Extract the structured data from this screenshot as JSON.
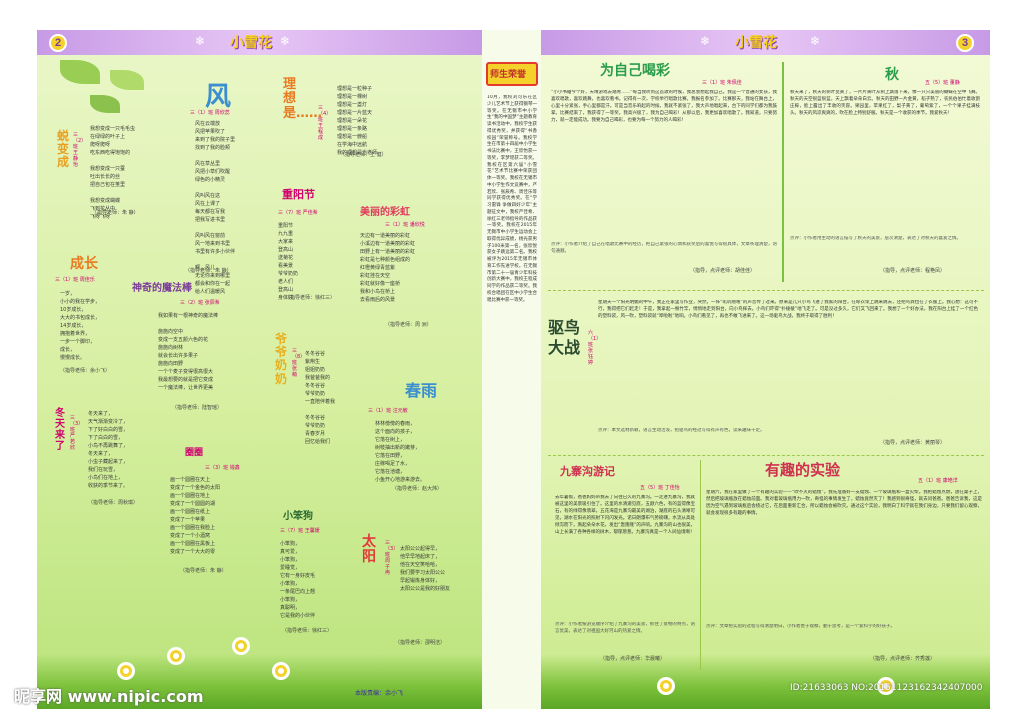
{
  "header": {
    "left_page_num": "2",
    "right_page_num": "3",
    "masthead": "小雪花",
    "spine_title": "师生荣誉",
    "snowflake": "❄"
  },
  "left": {
    "feng": {
      "title": "风",
      "author": "三（1）班 周欣蕊",
      "lines": [
        "风在云端放",
        "风把苹果吹了",
        "来到了我的院子里",
        "找到了我的脸颊",
        "",
        "风在草丛里",
        "风把小草们吹醒",
        "绿色的小精灵",
        "",
        "风叫风在这",
        "风在上课了",
        "每天都在写我",
        "把我写进书里",
        "",
        "风叫风在窗前",
        "风一地来到书里",
        "书里有许多小伙伴",
        "",
        "啊，风儿",
        "无论你来到哪里",
        "都会和你在一起",
        "给人们温暖风"
      ],
      "teacher": "（指导老师：朱 静）"
    },
    "bianc": {
      "title": "蜕变成",
      "author": "三（2）班 王静怡",
      "lines": [
        "我想变成一只毛毛虫",
        "在绿绿的叶子上",
        "爬呀爬呀",
        "吃东西吃得饱饱的",
        "",
        "我想变成一只蚕",
        "吐出长长的丝",
        "把自己包在茧里",
        "",
        "我想变成蝴蝶",
        "飞到花丛中",
        "飞呀飞呀"
      ],
      "teacher": "（指导老师：朱 静）"
    },
    "lixiang": {
      "title": "理想是……",
      "author": "三（4）班 王程成",
      "lines": [
        "理想是一粒种子",
        "理想是一棵树",
        "理想是一盏灯",
        "理想是一片蓝天",
        "理想是一朵花",
        "理想是一条路",
        "理想是一艘船",
        "在学海中远航",
        "我的理想是当老师"
      ],
      "teacher": "（指导老师：王 健）"
    },
    "chengzhang": {
      "title": "成长",
      "author": "三（1）班 周佳乐",
      "lines": [
        "一岁，",
        "小小的我在学步，",
        "10岁成长，",
        "大大的书包成长，",
        "14岁成长，",
        "拥抱着世界，",
        "一步一个脚印，",
        "成长，",
        "慢慢成长。"
      ],
      "teacher": "（指导老师：余小飞）"
    },
    "mofa": {
      "title": "神奇的魔法棒",
      "author": "三（2）班 张辰希",
      "lines": [
        "我如果有一根神奇的魔法棒",
        "",
        "施施向空中",
        "变成一支五颜六色的花",
        "施施向树林",
        "就会长出许多果子",
        "施施向田野",
        "一个个麦子变得很高很大",
        "我最想要的就是把它变成",
        "一个魔法棒，让世界更美"
      ],
      "teacher": "（指导老师：陆智瑶）"
    },
    "chongyang": {
      "title": "重阳节",
      "author": "三（7）班 严佳希",
      "lines": [
        "重阳节",
        "九九重",
        "大家来",
        "登高山",
        "送菊花",
        "看美景",
        "爷爷奶奶",
        "老人们",
        "登高山",
        "身体好"
      ],
      "teacher": "（指导老师：徐红三）"
    },
    "meili": {
      "title": "美丽的彩虹",
      "author": "三（1）班 潘欣悦",
      "lines": [
        "天边有一道美丽的彩虹",
        "小溪边有一道美丽的彩虹",
        "田野上有一道美丽的彩虹",
        "彩虹是七种颜色组成的",
        "红橙黄绿青蓝紫",
        "彩虹挂在天空",
        "彩虹就好像一座桥",
        "我和小鸟在桥上",
        "去看雨后的风景"
      ],
      "teacher": "（指导老师：周 洲）"
    },
    "yeye": {
      "title": "爷爷奶奶",
      "author": "三（8）班 张萌",
      "lines": [
        "冬冬谷谷",
        "紫荆生",
        "姐姐奶奶",
        "我爸爸我的",
        "冬冬谷谷",
        "爷爷奶奶",
        "一直陪伴着我",
        "",
        "冬冬谷谷",
        "爷爷奶奶",
        "青春岁月",
        "回忆给我们"
      ],
      "teacher": ""
    },
    "quanquan": {
      "title": "圈圈",
      "author": "三（3）班 钱鑫",
      "lines": [
        "画一个圆圈在天上",
        "变成了一个金色的太阳",
        "画一个圆圈在地上",
        "变成了一个圆圆的湖",
        "画一个圆圈在纸上",
        "变成了一个苹果",
        "画一个圆圈在我脸上",
        "变成了一个小酒窝",
        "画一个圆圈在黑板上",
        "变成了一个大大的零"
      ],
      "teacher": "（指导老师：朱 静）"
    },
    "chunyu": {
      "title": "春雨",
      "author": "三（1）班 汪元敏",
      "lines": [
        "林林傍傍的春雨，",
        "这个面向的孩子，",
        "它落在树上，",
        "树枝抽出新的嫩芽，",
        "它落在田野，",
        "庄稼喝足了水，",
        "它落在池塘，",
        "小鱼开心地游来游去。"
      ],
      "teacher": "（指导老师：赵大炜）"
    },
    "xiaogou": {
      "title": "小笨狗",
      "author": "三（7）班 王馨媛",
      "lines": [
        "小笨狗，",
        "真可爱，",
        "小笨狗，",
        "爱睡觉，",
        "它有一身好皮毛",
        "小笨狗，",
        "一条尾巴向上翘",
        "小笨狗，",
        "真聪明，",
        "它是我的小伙伴"
      ],
      "teacher": "（指导老师：徐红三）"
    },
    "taiyang": {
      "title": "太阳",
      "author": "三（3）班 周子冉",
      "lines": [
        "太阳公公起得早，",
        "他早早地起床了，",
        "他在天空笑哈哈，",
        "我们要学习太阳公公",
        "早起锻炼身体好，",
        "太阳公公是我的好朋友"
      ],
      "teacher": "（指导老师：邵明洁）"
    },
    "dongtian": {
      "title": "冬天来了",
      "author": "三（3）班 严若欣",
      "lines": [
        "冬天来了，",
        "天气渐渐变冷了，",
        "下了好白白的雪，",
        "下了白白的雪，",
        "小鸟不再跳舞了，",
        "冬天来了，",
        "小虫子藏起来了，",
        "我们在玩雪，",
        "小鸟们在地上，",
        "收获的季节来了。"
      ],
      "teacher": "（指导老师：周秋琪）"
    },
    "footer": "本版责编：余小飞"
  },
  "spine": {
    "text": "10月，我校刘可乐在区少儿艺术节上获得钢琴一等奖。在无锡市中小学生“我的中国梦”主题教育读书活动中，我校学生获得优秀奖，并获得“书香校园”荣誉称号。我校学生在市第十四届中小学生书法比赛中，王欣怡获一等奖，李梦瑶获二等奖。我校在区第六届“小雪花”艺术节比赛中荣获团体一等奖。我校在无锡市中小学生作文竞赛中，严若欣、张辰希、周佳乐等同学获得优秀奖。在“学习雷锋 争做四好少年”主题征文中，我校严佳希、徐红三老师指导的作品获一等奖。我校在2015年无锡市中小学生运动会上取得优异成绩，杨光获男子100米第一名，张欣悦获女子跳远第二名。我校被评为2015年无锡市体育工作先进学校。在无锡市第二十一届青少年科技创新大赛中，我校王程成同学的作品获二等奖。我校合唱团在区中小学生合唱比赛中获一等奖。"
  },
  "right": {
    "wei": {
      "title": "为自己喝彩",
      "author": "三（1）班 朱佩佳",
      "text": "“小小书籍今个好，天晴游戏去踏青……”每当我听到这首歌的时候，我总会想起我自己。我是一个普通的女孩，我喜欢唱歌，喜欢跳舞，也喜欢看书。记得有一次，学校举行唱歌比赛，我报名参加了。比赛那天，我站在舞台上，心里十分紧张，手心里都是汗。可是当音乐响起的时候，我就不紧张了，我大声地唱起来，台下的同学们都为我鼓掌。比赛结束了，我获得了一等奖。我高兴极了，我为自己喝彩！从那以后，我更加喜欢唱歌了。我知道，只要努力，就一定能成功。我要为自己喝彩，也要为每一个努力的人喝彩！",
      "comment": "点评：小作者介绍了自己在唱歌比赛中的经历，把自己紧张的心情和获奖后的喜悦写得很具体，文章条理清楚，语句通顺。",
      "teacher": "（指导，点评老师：胡佳佳）"
    },
    "qiu": {
      "title": "秋",
      "author": "五（5）班 董静",
      "text": "秋天来了，秋天的树叶变黄了，一片片黄叶从树上飘落下来，像一只只美丽的蝴蝶在空中飞舞。秋天的天空很蓝很蓝，天上飘着朵朵白云。秋天的田野一片金黄，稻子熟了，农民伯伯忙着收割庄稼，脸上露出了丰收的笑容。果园里，苹果红了，梨子黄了，葡萄紫了，一个个果子挂满枝头。秋天的风凉爽爽的，吹在脸上特别舒服。秋天是一个收获的季节，我爱秋天！",
      "comment": "点评：小作者用生动的语言描写了秋天的美景，层次清楚，表达了对秋天的喜爱之情。",
      "teacher": "（指导，点评老师：程艳凤）"
    },
    "quniao": {
      "title": "驱鸟大战",
      "author": "六（1）班 张钰婷",
      "text": "星期天一个阳光明媚的中午，我正在家里写作业，突然，一阵“叽叽喳喳”的声音传了过来。原来是几只小鸟飞进了我家的阳台，在晾衣架上跳来跳去，还把鸟粪拉在了衣服上。我心想：这可不行，我得把它们赶走！于是，我拿起一根竹竿，悄悄地走到阳台，向小鸟挥去。小鸟们吓得“扑棱棱”地飞走了。可是没过多久，它们又飞回来了。我想了一个好办法，我在阳台上挂了一个红色的塑料袋，风一吹，塑料袋就“哗啦啦”地响。小鸟们看见了，再也不敢飞进来了。这一场驱鸟大战，我终于取得了胜利！",
      "comment": "点评：本文选材新颖，语言生动活泼，把驱鸟的经过写得有声有色，读来趣味十足。",
      "teacher": "（指导，点评老师：黄丽琴）"
    },
    "jiuzhai": {
      "title": "九寨沟游记",
      "author": "五（5）班 丁佳怡",
      "text": "去年暑假，爸爸妈妈带我去了向往已久的九寨沟。一走进九寨沟，我就被这里的美景吸引住了。这里的水清澈见底，五颜六色，有的蓝得像宝石，有的绿得像翡翠。五花海是九寨沟最美的湖泊，湖底的石头清晰可见，湖水在阳光的照射下闪闪发光。诺日朗瀑布气势磅礴，水流从高处倾泻而下，溅起朵朵水花，发出“轰隆隆”的声响。九寨沟的山也很美，山上长满了各种各样的树木，郁郁葱葱。九寨沟真是一个人间仙境啊！",
      "comment": "点评：小作者按游览顺序介绍了九寨沟的美景，抓住了景物的特点，语言优美，表达了对祖国大好河山的热爱之情。",
      "teacher": "（指导，点评老师：华晨曦）"
    },
    "shiyan": {
      "title": "有趣的实验",
      "author": "五（1）班 康皓洋",
      "text": "星期六，我在家里做了一个有趣的实验——“吹不灭的蜡烛”。我先准备好一支蜡烛、一个玻璃瓶和一盒火柴。我把蜡烛点燃，放在桌子上，然后把玻璃瓶放在蜡烛前面。我对着玻璃瓶用力一吹，奇怪的事情发生了，蜡烛竟然灭了！我感到很奇怪，就去问爸爸。爸爸告诉我，这是因为空气遇到玻璃瓶后会绕过它，在后面重新汇合，所以蜡烛会被吹灭。通过这个实验，我明白了科学就在我们身边，只要我们留心观察，就会发现很多有趣的事情。",
      "comment": "点评：文章把实验的过程写得清楚明白，小作者善于观察，勤于思考，是一个爱科学的好孩子。",
      "teacher": "（指导，点评老师：齐秀莲）"
    }
  },
  "watermark": {
    "left": "昵享网 www.nipic.com",
    "right": "ID:21633063 NO:20151123162342407000"
  }
}
